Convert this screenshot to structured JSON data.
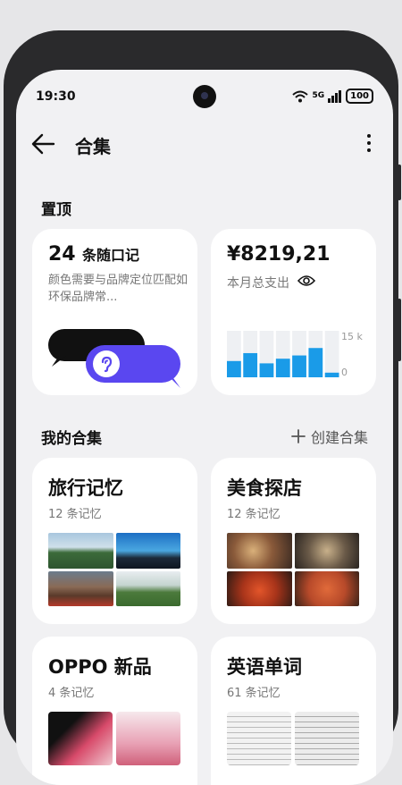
{
  "status_bar": {
    "time": "19:30",
    "network": "5G",
    "battery": "100"
  },
  "header": {
    "title": "合集"
  },
  "pinned": {
    "section_title": "置顶",
    "memo_card": {
      "count": "24",
      "title_suffix": "条随口记",
      "body": "颜色需要与品牌定位匹配如环保品牌常..."
    },
    "expense_card": {
      "amount": "¥8219,21",
      "label": "本月总支出",
      "axis_max": "15 k",
      "axis_min": "0",
      "bar_values": [
        0.35,
        0.52,
        0.3,
        0.4,
        0.47,
        0.63,
        0.1
      ]
    }
  },
  "collections": {
    "section_title": "我的合集",
    "create_label": "创建合集",
    "items": [
      {
        "title": "旅行记忆",
        "count": "12 条记忆"
      },
      {
        "title": "美食探店",
        "count": "12 条记忆"
      },
      {
        "title": "OPPO 新品",
        "count": "4 条记忆"
      },
      {
        "title": "英语单词",
        "count": "61 条记忆"
      }
    ]
  },
  "colors": {
    "accent_blue": "#1a9be8",
    "accent_purple": "#5a47f0"
  }
}
